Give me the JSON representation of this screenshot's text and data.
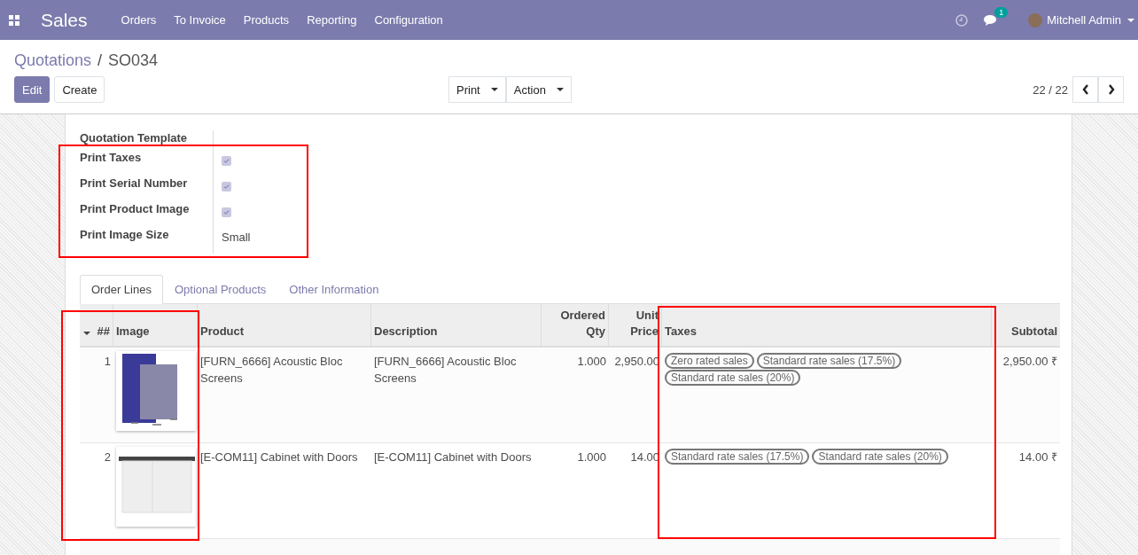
{
  "navbar": {
    "app": "Sales",
    "menu": [
      "Orders",
      "To Invoice",
      "Products",
      "Reporting",
      "Configuration"
    ],
    "messages_badge": "1",
    "user": "Mitchell Admin"
  },
  "breadcrumb": {
    "parent": "Quotations",
    "separator": "/",
    "current": "SO034"
  },
  "buttons": {
    "edit": "Edit",
    "create": "Create",
    "print": "Print",
    "action": "Action"
  },
  "pager": "22 / 22",
  "fields": [
    {
      "label": "Quotation Template",
      "kind": "empty"
    },
    {
      "label": "Print Taxes",
      "kind": "checkbox",
      "checked": true
    },
    {
      "label": "Print Serial Number",
      "kind": "checkbox",
      "checked": true
    },
    {
      "label": "Print Product Image",
      "kind": "checkbox",
      "checked": true
    },
    {
      "label": "Print Image Size",
      "kind": "text",
      "value": "Small"
    }
  ],
  "tabs": [
    {
      "label": "Order Lines",
      "selected": true
    },
    {
      "label": "Optional Products",
      "selected": false
    },
    {
      "label": "Other Information",
      "selected": false
    }
  ],
  "table": {
    "columns": [
      "##",
      "Image",
      "Product",
      "Description",
      "Ordered Qty",
      "Unit Price",
      "Taxes",
      "Subtotal"
    ],
    "rows": [
      {
        "number": "1",
        "product": "[FURN_6666] Acoustic Bloc Screens",
        "description": "[FURN_6666] Acoustic Bloc Screens",
        "qty": "1.000",
        "price": "2,950.00",
        "taxes": [
          "Zero rated sales",
          "Standard rate sales (17.5%)",
          "Standard rate sales (20%)"
        ],
        "subtotal": "2,950.00 ₹"
      },
      {
        "number": "2",
        "product": "[E-COM11] Cabinet with Doors",
        "description": "[E-COM11] Cabinet with Doors",
        "qty": "1.000",
        "price": "14.00",
        "taxes": [
          "Standard rate sales (17.5%)",
          "Standard rate sales (20%)"
        ],
        "subtotal": "14.00 ₹"
      }
    ]
  }
}
